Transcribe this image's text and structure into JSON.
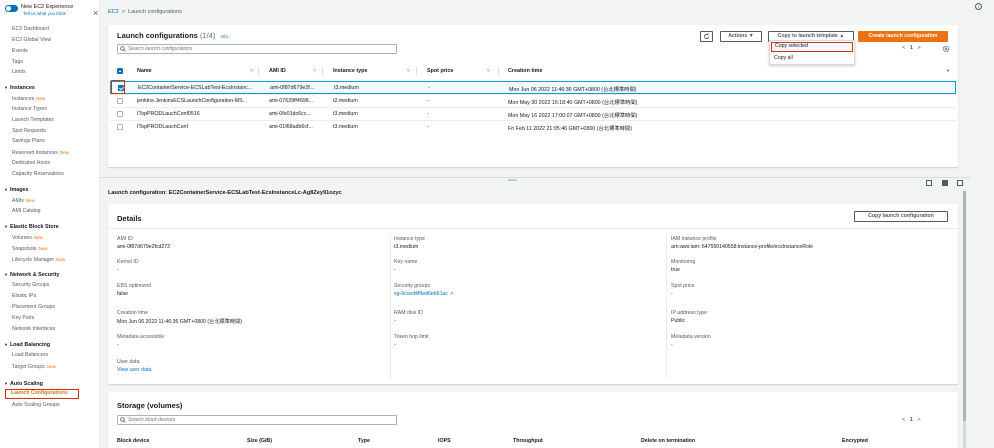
{
  "sidebar": {
    "new_experience": "New EC2 Experience",
    "new_experience_sub": "Tell us what you think",
    "items": [
      {
        "label": "EC2 Dashboard",
        "type": "item"
      },
      {
        "label": "EC2 Global View",
        "type": "item"
      },
      {
        "label": "Events",
        "type": "item"
      },
      {
        "label": "Tags",
        "type": "item"
      },
      {
        "label": "Limits",
        "type": "item"
      },
      {
        "label": "Instances",
        "type": "head"
      },
      {
        "label": "Instances",
        "badge": "New",
        "type": "item"
      },
      {
        "label": "Instance Types",
        "type": "item"
      },
      {
        "label": "Launch Templates",
        "type": "item"
      },
      {
        "label": "Spot Requests",
        "type": "item"
      },
      {
        "label": "Savings Plans",
        "type": "item"
      },
      {
        "label": "Reserved Instances",
        "badge": "New",
        "type": "item"
      },
      {
        "label": "Dedicated Hosts",
        "type": "item"
      },
      {
        "label": "Capacity Reservations",
        "type": "item"
      },
      {
        "label": "Images",
        "type": "head"
      },
      {
        "label": "AMIs",
        "badge": "New",
        "type": "item"
      },
      {
        "label": "AMI Catalog",
        "type": "item"
      },
      {
        "label": "Elastic Block Store",
        "type": "head"
      },
      {
        "label": "Volumes",
        "badge": "New",
        "type": "item"
      },
      {
        "label": "Snapshots",
        "badge": "New",
        "type": "item"
      },
      {
        "label": "Lifecycle Manager",
        "badge": "New",
        "type": "item"
      },
      {
        "label": "Network & Security",
        "type": "head"
      },
      {
        "label": "Security Groups",
        "type": "item"
      },
      {
        "label": "Elastic IPs",
        "type": "item"
      },
      {
        "label": "Placement Groups",
        "type": "item"
      },
      {
        "label": "Key Pairs",
        "type": "item"
      },
      {
        "label": "Network Interfaces",
        "type": "item"
      },
      {
        "label": "Load Balancing",
        "type": "head"
      },
      {
        "label": "Load Balancers",
        "type": "item"
      },
      {
        "label": "Target Groups",
        "badge": "New",
        "type": "item"
      },
      {
        "label": "Auto Scaling",
        "type": "head"
      },
      {
        "label": "Launch Configurations",
        "type": "active"
      },
      {
        "label": "Auto Scaling Groups",
        "type": "item"
      }
    ]
  },
  "breadcrumb": {
    "root": "EC2",
    "sep": ">",
    "current": "Launch configurations"
  },
  "launch_configs": {
    "title": "Launch configurations",
    "count": "(1/4)",
    "info": "Info",
    "search_placeholder": "Search launch configurations",
    "refresh_icon": "refresh-icon",
    "actions_label": "Actions ▼",
    "copy_template_label": "Copy to launch template ▲",
    "create_label": "Create launch configuration",
    "page": "1",
    "prev": "<",
    "next": ">",
    "dropdown": {
      "copy_selected": "Copy selected",
      "copy_all": "Copy all"
    },
    "columns": [
      "Name",
      "AMI ID",
      "Instance type",
      "Spot price",
      "Creation time"
    ],
    "rows": [
      {
        "name": "EC2ContainerService-ECSLabTest-EcsInstanc...",
        "ami": "ami-0f87d679e2f...",
        "type": "t3.medium",
        "spot": "-",
        "created": "Mon Jun 06 2022 11:46:36 GMT+0800 (台北標準時間)",
        "selected": true
      },
      {
        "name": "jenkins-JenkinsECSLaunchConfiguration-MS...",
        "ami": "ami-07639ff4598...",
        "type": "t2.medium",
        "spot": "-",
        "created": "Mon May 30 2022 16:18:40 GMT+0800 (台北標準時間)",
        "selected": false
      },
      {
        "name": "ITopPRODLauchConf0516",
        "ami": "ami-0fe01dc6cc...",
        "type": "t3.medium",
        "spot": "-",
        "created": "Mon May 16 2022 17:00:07 GMT+0800 (台北標準時間)",
        "selected": false
      },
      {
        "name": "ITopPRODLauchConf",
        "ami": "ami-01f68adb6cf...",
        "type": "t3.medium",
        "spot": "-",
        "created": "Fri Feb 11 2022 21:05:46 GMT+0800 (台北標準時間)",
        "selected": false
      }
    ]
  },
  "bottom": {
    "title": "Launch configuration: EC2ContainerService-ECSLabTest-EcsInstanceLc-Ag8Zey91ozyc",
    "handle": "===",
    "details_title": "Details",
    "copy_button": "Copy launch configuration",
    "fields": {
      "ami_label": "AMI ID",
      "ami_value": "ami-0f87d679e2fcd272",
      "kernel_label": "Kernel ID",
      "kernel_value": "-",
      "ebs_label": "EBS optimized",
      "ebs_value": "false",
      "ctime_label": "Creation time",
      "ctime_value": "Mon Jun 06 2022 11:46:36 GMT+0800 (台北標準時間)",
      "meta_label": "Metadata accessible",
      "meta_value": "-",
      "userdata_label": "User data",
      "userdata_value": "View user data",
      "itype_label": "Instance type",
      "itype_value": "t3.medium",
      "key_label": "Key name",
      "key_value": "-",
      "sg_label": "Security groups",
      "sg_value": "sg-0cced4f9ed6eb61ac",
      "ram_label": "RAM disk ID",
      "ram_value": "-",
      "token_label": "Token hop limit",
      "token_value": "-",
      "iam_label": "IAM instance profile",
      "iam_value": "arn:aws:iam::647550140558:instance-profile/ecsInstanceRole",
      "mon_label": "Monitoring",
      "mon_value": "true",
      "spot_label": "Spot price",
      "spot_value": "-",
      "ip_label": "IP address type",
      "ip_value": "Public",
      "metaver_label": "Metadata version",
      "metaver_value": "-"
    },
    "storage_title": "Storage (volumes)",
    "storage_search_placeholder": "Search block devices",
    "storage_page": "1",
    "storage_columns": [
      "Block device",
      "Size (GiB)",
      "Type",
      "IOPS",
      "Throughput",
      "Delete on termination",
      "Encrypted"
    ]
  }
}
